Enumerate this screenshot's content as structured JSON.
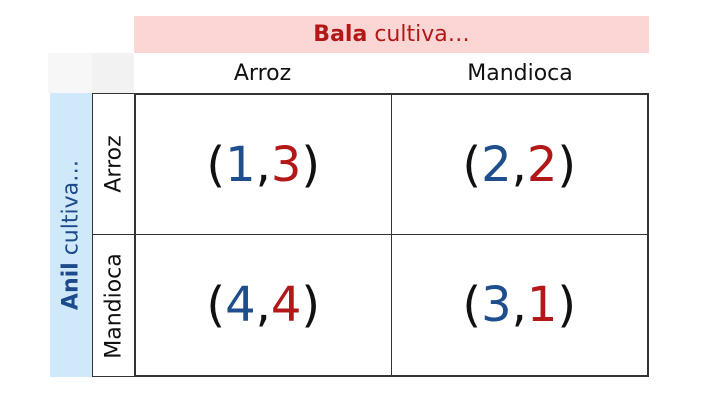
{
  "column_player": {
    "name": "Bala",
    "verb": "cultiva…",
    "color": "#b21818",
    "background": "#fcd5d5"
  },
  "row_player": {
    "name": "Anil",
    "verb": "cultiva…",
    "color": "#1c4a8c",
    "background": "#cfe9fa"
  },
  "column_strategies": [
    "Arroz",
    "Mandioca"
  ],
  "row_strategies": [
    "Arroz",
    "Mandioca"
  ],
  "payoffs": [
    [
      {
        "open": "(",
        "a": "1",
        "sep": ",",
        "b": "3",
        "close": ")"
      },
      {
        "open": "(",
        "a": "2",
        "sep": ",",
        "b": "2",
        "close": ")"
      }
    ],
    [
      {
        "open": "(",
        "a": "4",
        "sep": ",",
        "b": "4",
        "close": ")"
      },
      {
        "open": "(",
        "a": "3",
        "sep": ",",
        "b": "1",
        "close": ")"
      }
    ]
  ],
  "colors": {
    "row_payoff": "#1f4e8c",
    "column_payoff": "#b21818",
    "grid_line": "#333333"
  }
}
